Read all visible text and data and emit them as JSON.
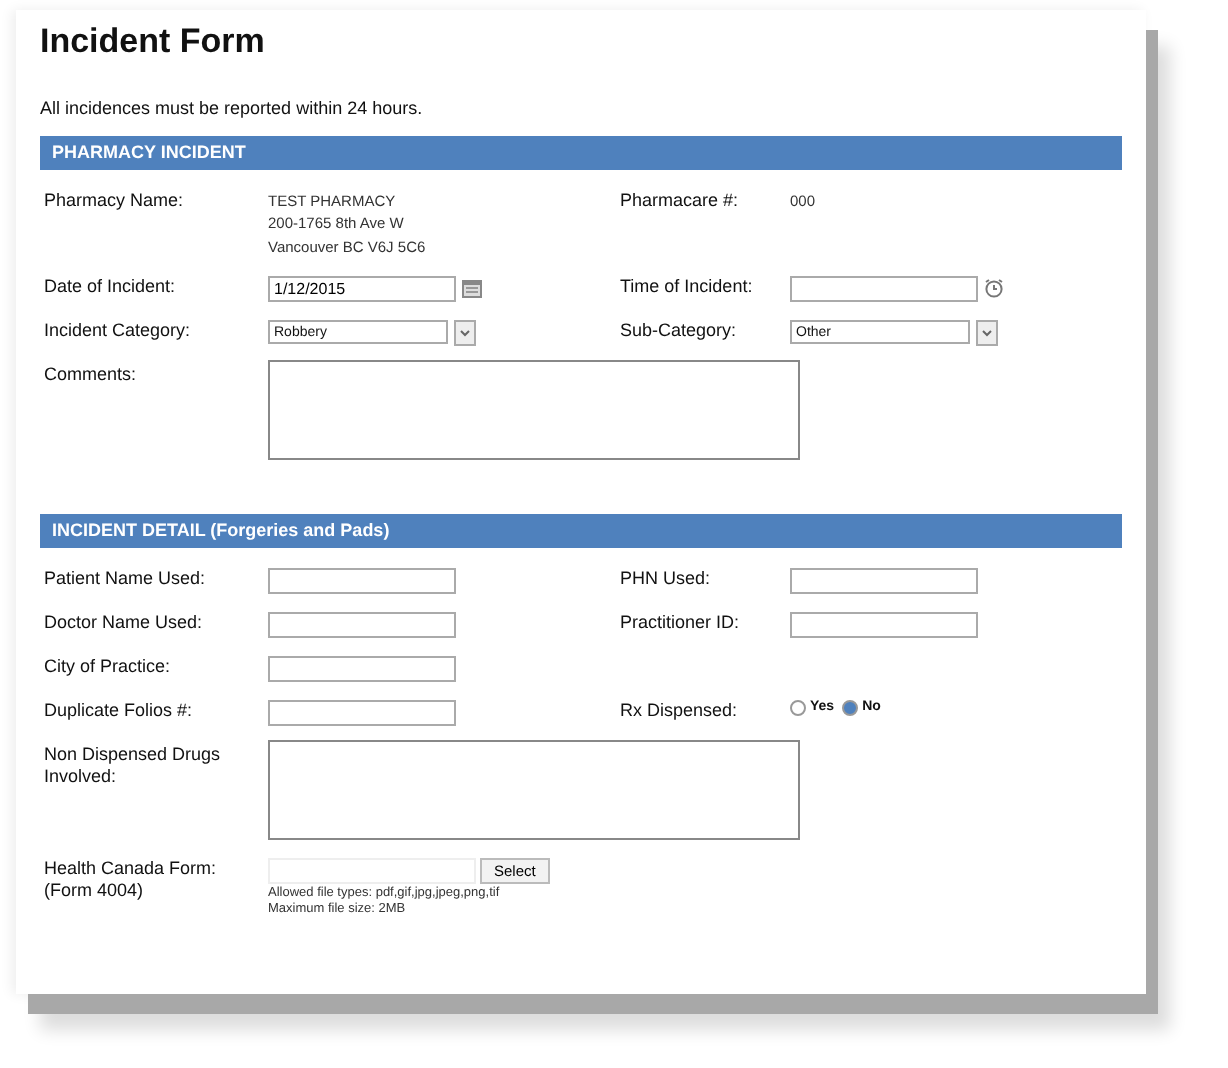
{
  "title": "Incident Form",
  "intro": "All incidences must be reported within 24 hours.",
  "sections": [
    {
      "header": "PHARMACY INCIDENT",
      "rows": [
        {
          "fields": [
            {
              "label": "Pharmacy Name:",
              "kind": "static",
              "lines": [
                "TEST PHARMACY",
                "200-1765 8th Ave W",
                "Vancouver BC V6J 5C6"
              ]
            },
            {
              "label": "Pharmacare #:",
              "kind": "static",
              "lines": [
                "000"
              ]
            }
          ]
        },
        {
          "fields": [
            {
              "label": "Date of Incident:",
              "kind": "date",
              "value": "1/12/2015"
            },
            {
              "label": "Time of Incident:",
              "kind": "time"
            }
          ]
        },
        {
          "fields": [
            {
              "label": "Incident Category:",
              "kind": "select",
              "value": "Robbery"
            },
            {
              "label": "Sub-Category:",
              "kind": "select",
              "value": "Other"
            }
          ]
        },
        {
          "fields": [
            {
              "label": "Comments:",
              "kind": "textarea"
            }
          ]
        }
      ]
    },
    {
      "header": "INCIDENT DETAIL (Forgeries and Pads)",
      "rows": [
        {
          "fields": [
            {
              "label": "Patient Name Used:",
              "kind": "input"
            },
            {
              "label": "PHN Used:",
              "kind": "input"
            }
          ]
        },
        {
          "fields": [
            {
              "label": "Doctor Name Used:",
              "kind": "input"
            },
            {
              "label": "Practitioner ID:",
              "kind": "input"
            }
          ]
        },
        {
          "fields": [
            {
              "label": "City of Practice:",
              "kind": "input"
            }
          ]
        },
        {
          "fields": [
            {
              "label": "Duplicate Folios #:",
              "kind": "input"
            },
            {
              "label": "Rx Dispensed:",
              "kind": "radio",
              "options": [
                {
                  "label": "Yes",
                  "selected": false
                },
                {
                  "label": "No",
                  "selected": true
                }
              ]
            }
          ]
        },
        {
          "fields": [
            {
              "label": "Non Dispensed Drugs Involved:",
              "kind": "textarea"
            }
          ]
        },
        {
          "fields": [
            {
              "label": "Health Canada Form: (Form 4004)",
              "kind": "file",
              "button": "Select",
              "notes": [
                "Allowed file types: pdf,gif,jpg,jpeg,png,tif",
                "Maximum file size: 2MB"
              ]
            }
          ]
        }
      ]
    }
  ]
}
